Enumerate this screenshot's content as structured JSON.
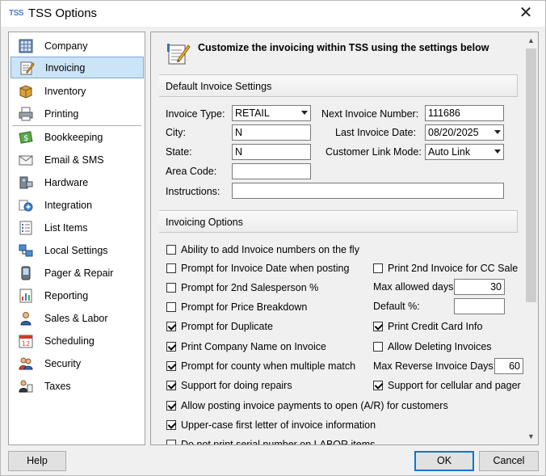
{
  "window": {
    "app_logo": "TSS",
    "title": "TSS Options",
    "close": "✕"
  },
  "nav": {
    "items": [
      {
        "label": "Company",
        "icon": "company-icon"
      },
      {
        "label": "Invoicing",
        "icon": "invoicing-icon",
        "selected": true
      },
      {
        "label": "Inventory",
        "icon": "inventory-icon"
      },
      {
        "label": "Printing",
        "icon": "printer-icon"
      },
      {
        "label": "Bookkeeping",
        "icon": "bookkeeping-icon"
      },
      {
        "label": "Email & SMS",
        "icon": "email-icon"
      },
      {
        "label": "Hardware",
        "icon": "hardware-icon"
      },
      {
        "label": "Integration",
        "icon": "integration-icon"
      },
      {
        "label": "List Items",
        "icon": "list-items-icon"
      },
      {
        "label": "Local Settings",
        "icon": "local-settings-icon"
      },
      {
        "label": "Pager & Repair",
        "icon": "pager-icon"
      },
      {
        "label": "Reporting",
        "icon": "reporting-icon"
      },
      {
        "label": "Sales & Labor",
        "icon": "sales-labor-icon"
      },
      {
        "label": "Scheduling",
        "icon": "calendar-icon"
      },
      {
        "label": "Security",
        "icon": "security-icon"
      },
      {
        "label": "Taxes",
        "icon": "taxes-icon"
      }
    ]
  },
  "panel": {
    "header": "Customize the invoicing within TSS using the settings below",
    "default_section": "Default Invoice Settings",
    "options_section": "Invoicing Options",
    "fields": {
      "invoice_type_label": "Invoice Type:",
      "invoice_type_value": "RETAIL",
      "city_label": "City:",
      "city_value": "N",
      "state_label": "State:",
      "state_value": "N",
      "area_code_label": "Area Code:",
      "area_code_value": "",
      "instructions_label": "Instructions:",
      "instructions_value": "",
      "next_invoice_label": "Next Invoice Number:",
      "next_invoice_value": "111686",
      "last_invoice_date_label": "Last Invoice Date:",
      "last_invoice_date_value": "08/20/2025",
      "customer_link_label": "Customer Link Mode:",
      "customer_link_value": "Auto Link"
    },
    "options_left": [
      {
        "label": "Ability to add Invoice numbers on the fly",
        "checked": false
      },
      {
        "label": "Prompt for Invoice Date when posting",
        "checked": false
      },
      {
        "label": "Prompt for 2nd Salesperson %",
        "checked": false
      },
      {
        "label": "Prompt for Price Breakdown",
        "checked": false
      },
      {
        "label": "Prompt for Duplicate",
        "checked": true
      },
      {
        "label": "Print Company Name on Invoice",
        "checked": true
      },
      {
        "label": "Prompt for county when multiple match",
        "checked": true
      },
      {
        "label": "Support for doing repairs",
        "checked": true
      },
      {
        "label": "Allow posting invoice payments to open (A/R) for customers",
        "checked": true
      },
      {
        "label": "Upper-case first letter of invoice information",
        "checked": true
      },
      {
        "label": "Do not print serial number on LABOR items",
        "checked": false
      }
    ],
    "options_right": {
      "print_2nd_cc_label": "Print 2nd Invoice for CC Sale",
      "print_2nd_cc_checked": false,
      "max_allowed_days_label": "Max allowed days:",
      "max_allowed_days_value": "30",
      "default_pct_label": "Default %:",
      "default_pct_value": "",
      "print_cc_info_label": "Print Credit Card Info",
      "print_cc_info_checked": true,
      "allow_deleting_label": "Allow Deleting Invoices",
      "allow_deleting_checked": false,
      "max_reverse_days_label": "Max Reverse Invoice Days:",
      "max_reverse_days_value": "60",
      "support_cellular_label": "Support for cellular and pager l",
      "support_cellular_checked": true
    }
  },
  "buttons": {
    "help": "Help",
    "ok": "OK",
    "cancel": "Cancel"
  }
}
